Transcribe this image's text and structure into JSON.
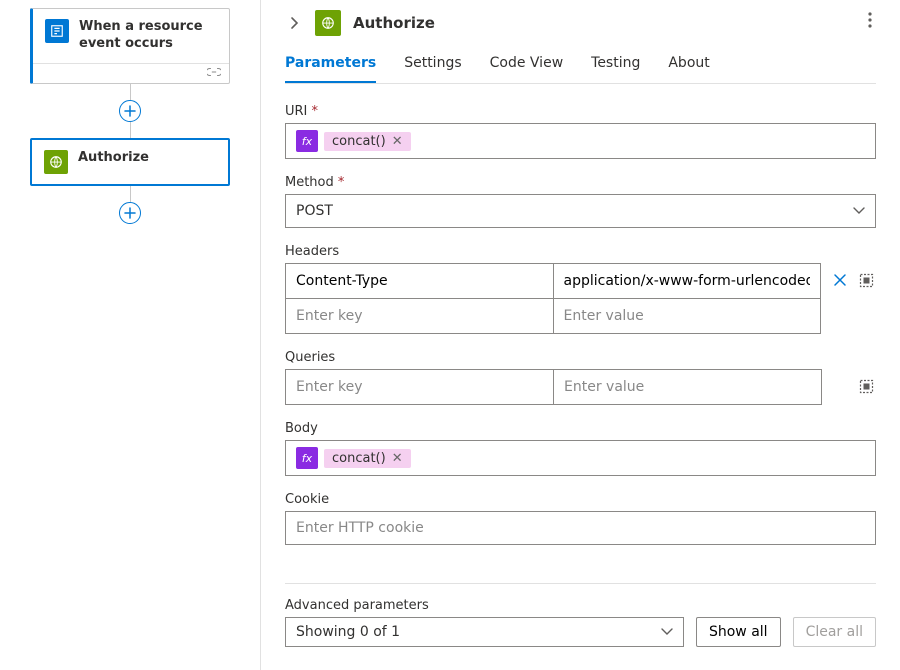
{
  "canvas": {
    "trigger": {
      "title": "When a resource event occurs"
    },
    "action": {
      "title": "Authorize"
    }
  },
  "panel": {
    "title": "Authorize",
    "tabs": {
      "parameters": "Parameters",
      "settings": "Settings",
      "code_view": "Code View",
      "testing": "Testing",
      "about": "About"
    },
    "fields": {
      "uri": {
        "label": "URI",
        "required": "*",
        "token": "concat()"
      },
      "method": {
        "label": "Method",
        "required": "*",
        "value": "POST"
      },
      "headers": {
        "label": "Headers",
        "rows": [
          {
            "key": "Content-Type",
            "value": "application/x-www-form-urlencoded"
          }
        ],
        "key_placeholder": "Enter key",
        "value_placeholder": "Enter value"
      },
      "queries": {
        "label": "Queries",
        "key_placeholder": "Enter key",
        "value_placeholder": "Enter value"
      },
      "body": {
        "label": "Body",
        "token": "concat()"
      },
      "cookie": {
        "label": "Cookie",
        "placeholder": "Enter HTTP cookie"
      }
    },
    "advanced": {
      "label": "Advanced parameters",
      "selected": "Showing 0 of 1",
      "show_all": "Show all",
      "clear_all": "Clear all"
    }
  }
}
